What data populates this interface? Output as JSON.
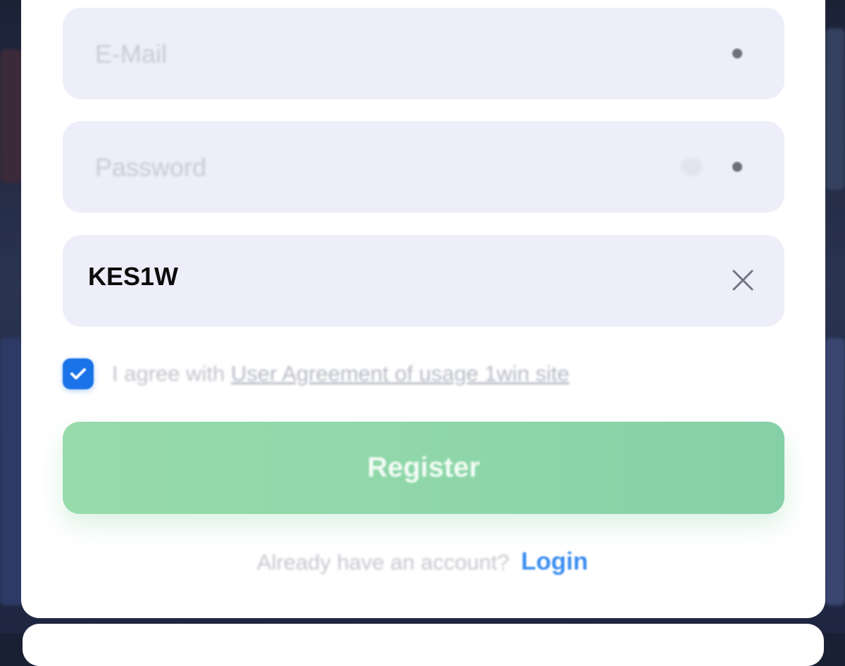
{
  "form": {
    "email": {
      "placeholder": "E-Mail",
      "value": ""
    },
    "password": {
      "placeholder": "Password",
      "value": ""
    },
    "promo_code": {
      "value": "KES1W"
    },
    "agreement": {
      "checked": true,
      "prefix": "I agree with",
      "link_label": "User Agreement of usage 1win site"
    },
    "register_label": "Register",
    "login_prompt": "Already have an account?",
    "login_label": "Login"
  },
  "icons": {
    "required": "required-dot-icon",
    "password_visibility": "eye-icon",
    "clear": "close-icon",
    "checkbox": "checkmark-icon"
  },
  "colors": {
    "field_background": "#eeeefa",
    "checkbox": "#1a73e8",
    "register_button": "#8dd6a9",
    "login_link": "#3d8ff0"
  }
}
